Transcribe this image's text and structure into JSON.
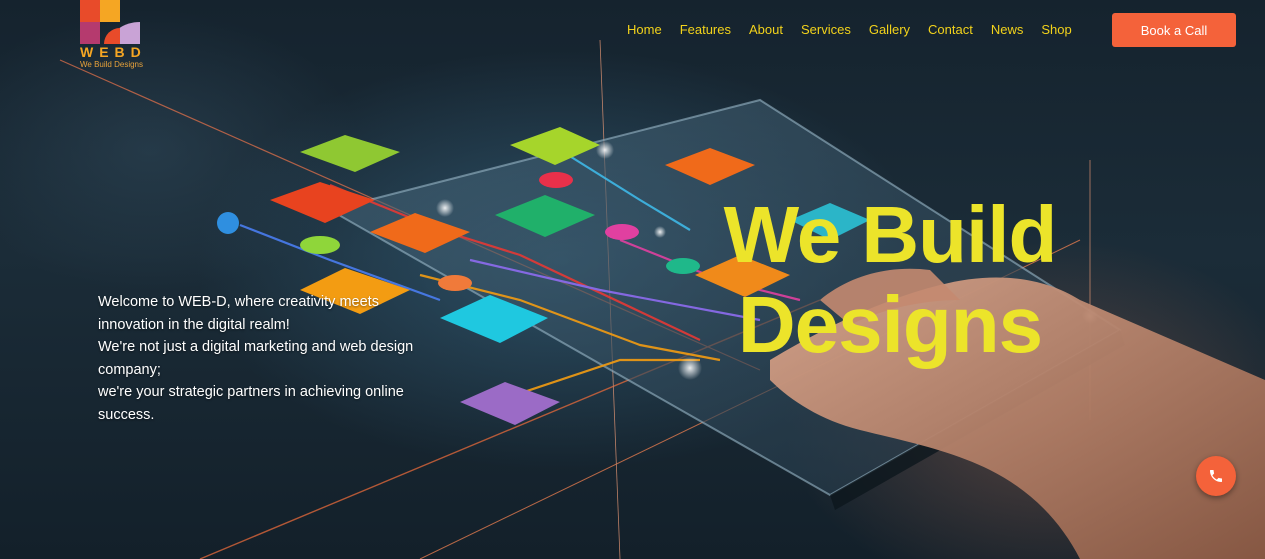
{
  "brand": {
    "letters": "WEBD",
    "tagline": "We Build Designs",
    "colors": [
      "#e84b2a",
      "#f5a623",
      "#b53a6e",
      "#c9a3d6"
    ]
  },
  "nav": {
    "items": [
      {
        "label": "Home"
      },
      {
        "label": "Features"
      },
      {
        "label": "About"
      },
      {
        "label": "Services"
      },
      {
        "label": "Gallery"
      },
      {
        "label": "Contact"
      },
      {
        "label": "News"
      },
      {
        "label": "Shop"
      }
    ],
    "color": "#f2d21b"
  },
  "cta": {
    "label": "Book a Call",
    "color": "#f4623a"
  },
  "hero": {
    "intro_lines": [
      "Welcome to WEB-D, where creativity meets",
      "innovation in the digital realm!",
      "We're not just a digital marketing and web design",
      "company;",
      "we're your strategic partners in achieving online",
      "success."
    ],
    "headline_lines": [
      "We Build",
      "Designs"
    ],
    "headline_color": "#ece42a"
  },
  "fab": {
    "icon": "phone-icon",
    "color": "#f4623a"
  }
}
